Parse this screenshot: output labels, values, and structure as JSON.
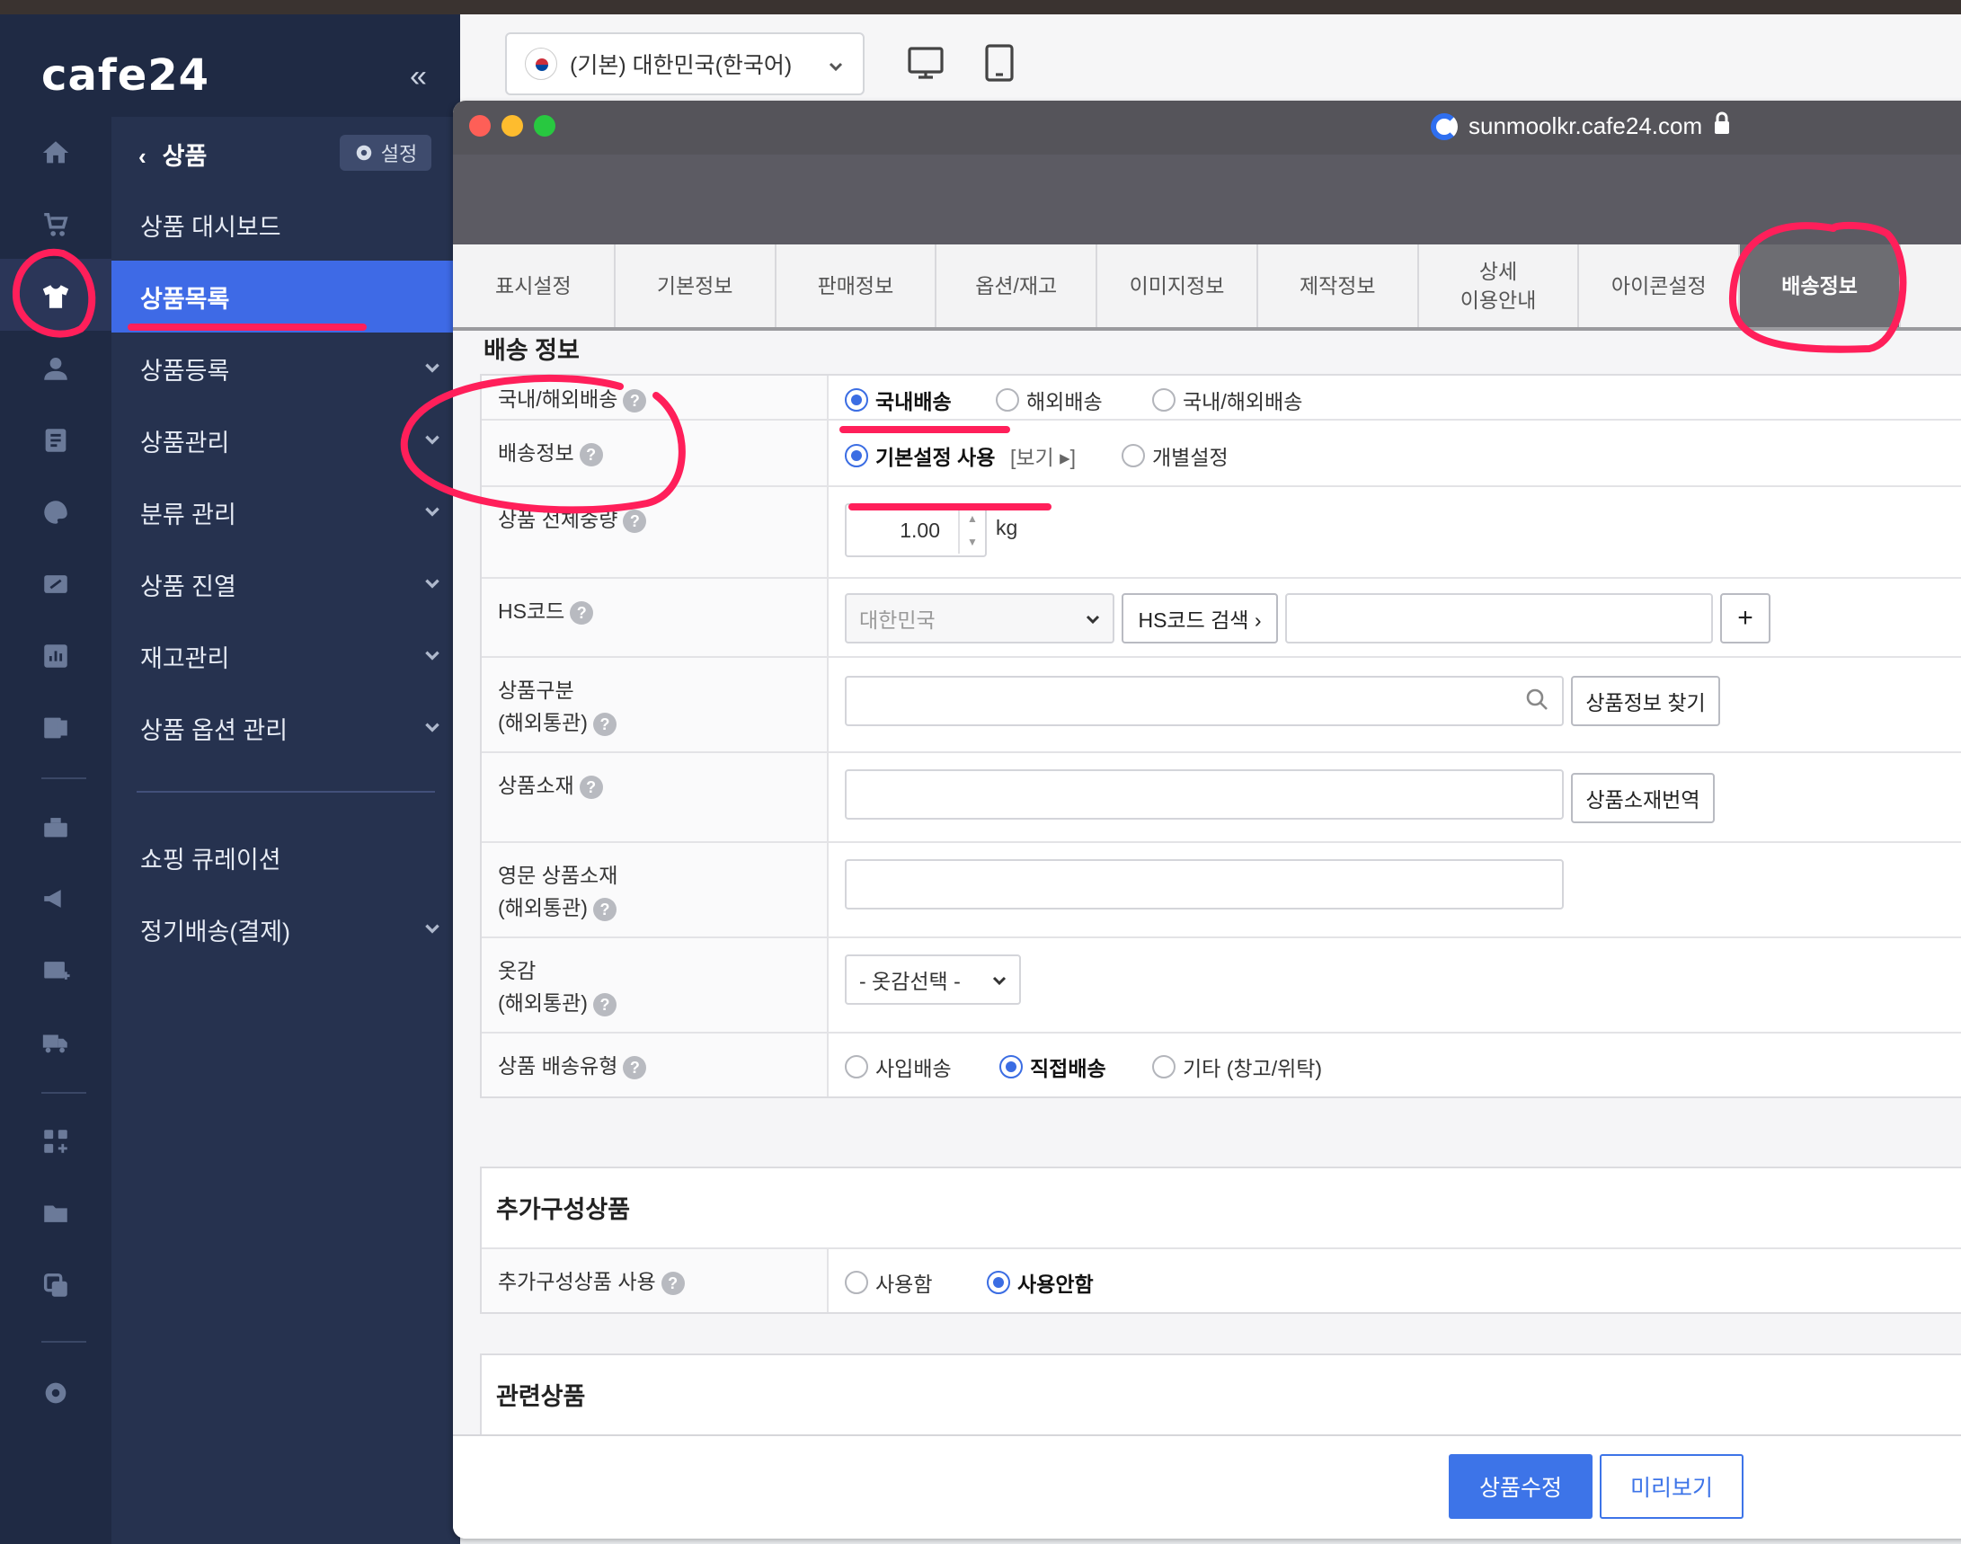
{
  "app": {
    "logo": "cafe24",
    "collapse_icon": "«"
  },
  "toolbar": {
    "language": "(기본) 대한민국(한국어)",
    "devices": [
      "desktop-icon",
      "tablet-icon"
    ]
  },
  "sidebar": {
    "header": "상품",
    "back": "‹",
    "settings_label": "설정",
    "items": [
      {
        "label": "상품 대시보드",
        "expandable": false
      },
      {
        "label": "상품목록",
        "expandable": false,
        "active": true
      },
      {
        "label": "상품등록",
        "expandable": true
      },
      {
        "label": "상품관리",
        "expandable": true
      },
      {
        "label": "분류 관리",
        "expandable": true
      },
      {
        "label": "상품 진열",
        "expandable": true
      },
      {
        "label": "재고관리",
        "expandable": true
      },
      {
        "label": "상품 옵션 관리",
        "expandable": true
      },
      {
        "label": "쇼핑 큐레이션",
        "expandable": false
      },
      {
        "label": "정기배송(결제)",
        "expandable": true
      }
    ]
  },
  "browser": {
    "url": "sunmoolkr.cafe24.com"
  },
  "tabs": [
    {
      "label": "표시설정"
    },
    {
      "label": "기본정보"
    },
    {
      "label": "판매정보"
    },
    {
      "label": "옵션/재고"
    },
    {
      "label": "이미지정보"
    },
    {
      "label": "제작정보"
    },
    {
      "label": "상세\n이용안내"
    },
    {
      "label": "아이콘설정"
    },
    {
      "label": "배송정보",
      "active": true
    }
  ],
  "shipping": {
    "title": "배송 정보",
    "rows": {
      "domestic": {
        "label": "국내/해외배송",
        "options": [
          "국내배송",
          "해외배송",
          "국내/해외배송"
        ],
        "selected": "국내배송"
      },
      "info": {
        "label": "배송정보",
        "options": [
          "기본설정 사용",
          "개별설정"
        ],
        "selected": "기본설정 사용",
        "view_link": "[보기 ▸]"
      },
      "weight": {
        "label": "상품 전체중량",
        "value": "1.00",
        "unit": "kg"
      },
      "hs": {
        "label": "HS코드",
        "country": "대한민국",
        "search_btn": "HS코드 검색 ›",
        "add_btn": "+"
      },
      "category": {
        "label_line1": "상품구분",
        "label_line2": "(해외통관)",
        "find_btn": "상품정보 찾기"
      },
      "material": {
        "label": "상품소재",
        "translate_btn": "상품소재번역"
      },
      "material_en": {
        "label_line1": "영문 상품소재",
        "label_line2": "(해외통관)"
      },
      "fabric": {
        "label_line1": "옷감",
        "label_line2": "(해외통관)",
        "select": "- 옷감선택 -"
      },
      "ship_type": {
        "label": "상품 배송유형",
        "options": [
          "사입배송",
          "직접배송",
          "기타 (창고/위탁)"
        ],
        "selected": "직접배송"
      }
    }
  },
  "addon": {
    "title": "추가구성상품",
    "label": "추가구성상품 사용",
    "options": [
      "사용함",
      "사용안함"
    ],
    "selected": "사용안함"
  },
  "related": {
    "title": "관련상품"
  },
  "footer": {
    "save": "상품수정",
    "preview": "미리보기"
  },
  "colors": {
    "accent": "#3d74e8",
    "sidebar": "#26324f",
    "rail": "#1f2a44",
    "annotation": "#ff1f5a"
  }
}
